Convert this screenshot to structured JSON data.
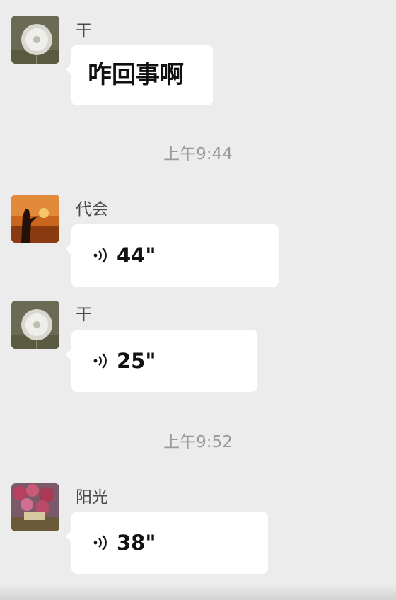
{
  "colors": {
    "background": "#ececec",
    "bubble": "#ffffff",
    "timestamp": "#9a9a9a",
    "sender": "#4a4a4a"
  },
  "messages": [
    {
      "sender": "干",
      "avatar_icon": "dandelion-avatar",
      "type": "text",
      "text": "咋回事啊"
    },
    {
      "type": "timestamp",
      "text": "上午9:44"
    },
    {
      "sender": "代会",
      "avatar_icon": "sunset-silhouette-avatar",
      "type": "voice",
      "voice_icon": "voice-wave-icon",
      "duration": "44\""
    },
    {
      "sender": "干",
      "avatar_icon": "dandelion-avatar",
      "type": "voice",
      "voice_icon": "voice-wave-icon",
      "duration": "25\""
    },
    {
      "type": "timestamp",
      "text": "上午9:52"
    },
    {
      "sender": "阳光",
      "avatar_icon": "flowers-avatar",
      "type": "voice",
      "voice_icon": "voice-wave-icon",
      "duration": "38\""
    }
  ]
}
